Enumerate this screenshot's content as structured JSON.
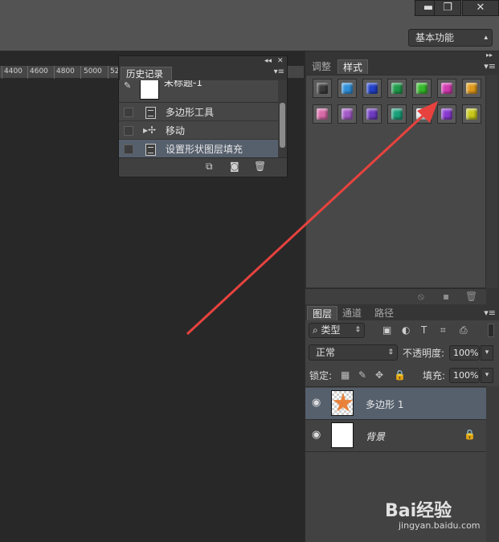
{
  "window": {
    "minimize_glyph": "▬",
    "restore_glyph": "❐",
    "close_glyph": "✕"
  },
  "options_bar": {
    "workspace": "基本功能"
  },
  "ruler": {
    "ticks": [
      "4400",
      "4600",
      "4800",
      "5000",
      "52"
    ]
  },
  "history_panel": {
    "tab_label": "历史记录",
    "snapshot_name": "未标题-1",
    "items": [
      {
        "label": "多边形工具",
        "icon": "document-icon"
      },
      {
        "label": "移动",
        "icon": "move-icon"
      },
      {
        "label": "设置形状图层填充",
        "icon": "document-icon",
        "selected": true
      }
    ]
  },
  "styles_panel": {
    "tabs": [
      "调整",
      "样式"
    ],
    "active_tab": "样式",
    "swatches": [
      "#3a3a3a",
      "#2f8fd8",
      "#2140c8",
      "#1f9a4a",
      "#35b82a",
      "#d23ab0",
      "#e09a1a",
      "#d86aa8",
      "#a45ac8",
      "#6d3ac0",
      "#19a07a",
      "#e7e7e7",
      "#8a3ad0",
      "#c8c81a"
    ]
  },
  "layers_panel": {
    "tabs": [
      "图层",
      "通道",
      "路径"
    ],
    "active_tab": "图层",
    "filter_kind": "类型",
    "blend_mode": "正常",
    "opacity_label": "不透明度:",
    "opacity_value": "100%",
    "lock_label": "锁定:",
    "fill_label": "填充:",
    "fill_value": "100%",
    "layers": [
      {
        "name": "多边形 1",
        "selected": true
      },
      {
        "name": "背景",
        "locked": true
      }
    ]
  },
  "watermark": {
    "brand": "Bai经验",
    "url": "jingyan.baidu.com"
  },
  "colors": {
    "arrow": "#e8423e",
    "selection": "#56606d"
  }
}
